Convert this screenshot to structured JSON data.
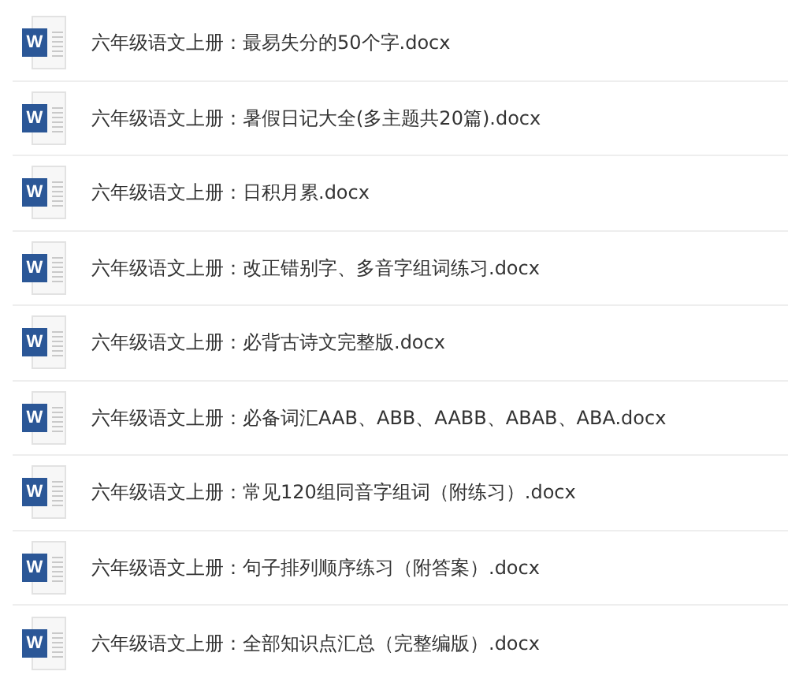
{
  "files": [
    {
      "icon_letter": "W",
      "name": "六年级语文上册：最易失分的50个字.docx"
    },
    {
      "icon_letter": "W",
      "name": "六年级语文上册：暑假日记大全(多主题共20篇).docx"
    },
    {
      "icon_letter": "W",
      "name": "六年级语文上册：日积月累.docx"
    },
    {
      "icon_letter": "W",
      "name": "六年级语文上册：改正错别字、多音字组词练习.docx"
    },
    {
      "icon_letter": "W",
      "name": "六年级语文上册：必背古诗文完整版.docx"
    },
    {
      "icon_letter": "W",
      "name": "六年级语文上册：必备词汇AAB、ABB、AABB、ABAB、ABA.docx"
    },
    {
      "icon_letter": "W",
      "name": "六年级语文上册：常见120组同音字组词（附练习）.docx"
    },
    {
      "icon_letter": "W",
      "name": "六年级语文上册：句子排列顺序练习（附答案）.docx"
    },
    {
      "icon_letter": "W",
      "name": "六年级语文上册：全部知识点汇总（完整编版）.docx"
    }
  ]
}
